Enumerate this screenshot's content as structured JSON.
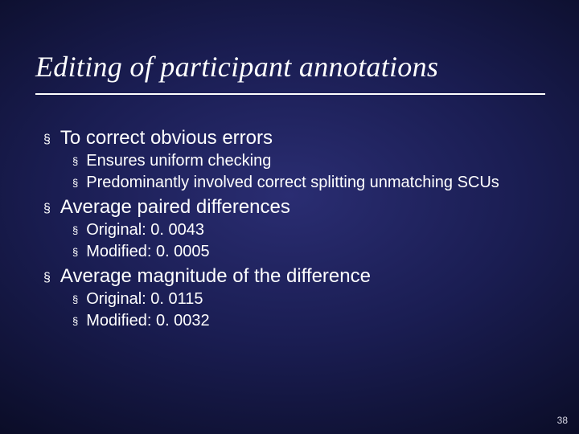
{
  "title": "Editing of participant annotations",
  "bullets": {
    "b1": "To correct obvious errors",
    "b1a": "Ensures uniform checking",
    "b1b": "Predominantly involved correct splitting unmatching SCUs",
    "b2": "Average paired differences",
    "b2a": "Original: 0. 0043",
    "b2b": "Modified: 0. 0005",
    "b3": "Average magnitude of the difference",
    "b3a": "Original: 0. 0115",
    "b3b": "Modified: 0. 0032"
  },
  "page_number": "38",
  "bullet_glyph": "§"
}
